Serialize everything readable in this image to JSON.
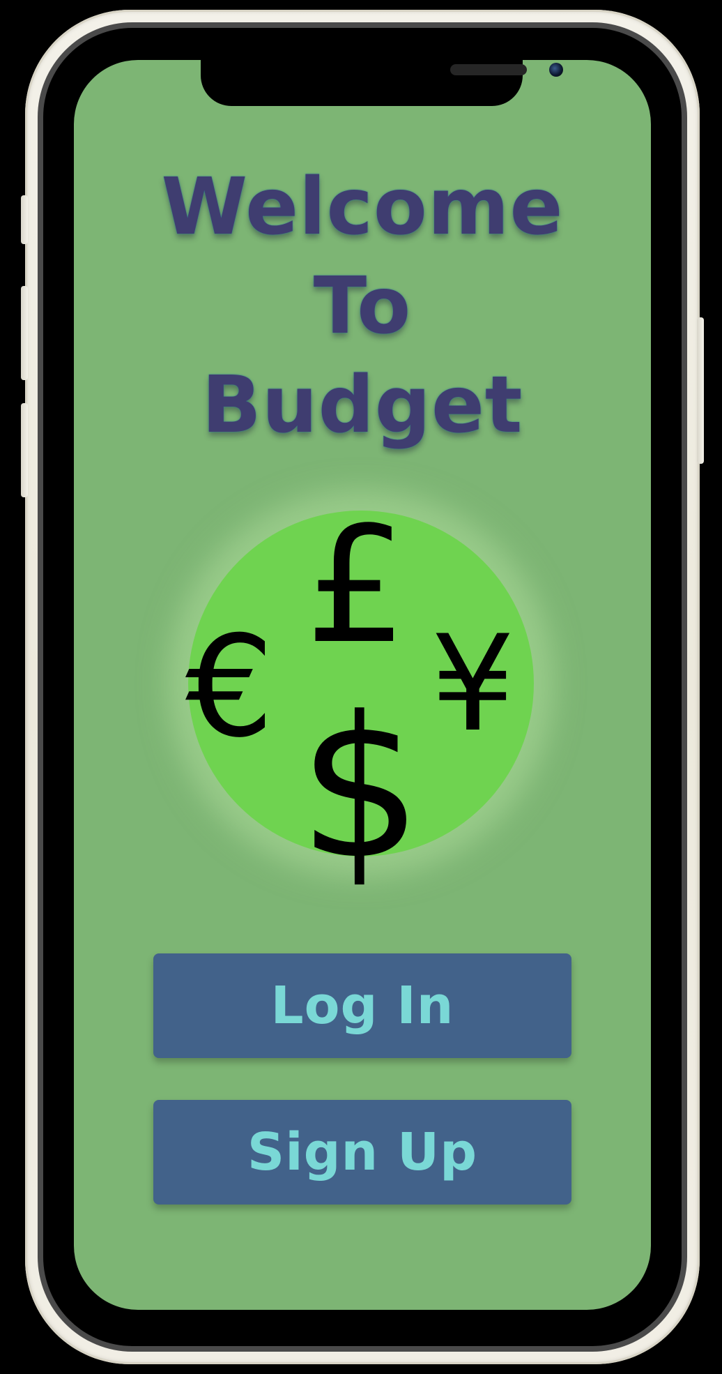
{
  "device": {
    "frame_color": "#f1eee5",
    "screen_background": "#7db574"
  },
  "welcome": {
    "lines": [
      "Welcome",
      "To",
      "Budget"
    ],
    "color": "#3f3d70"
  },
  "logo": {
    "circle_color": "#6fd350",
    "symbols": {
      "pound": "£",
      "euro": "€",
      "yen": "¥",
      "dollar": "$"
    }
  },
  "buttons": {
    "login_label": "Log In",
    "signup_label": "Sign Up",
    "background": "#42628a",
    "text_color": "#7ad8d6"
  }
}
